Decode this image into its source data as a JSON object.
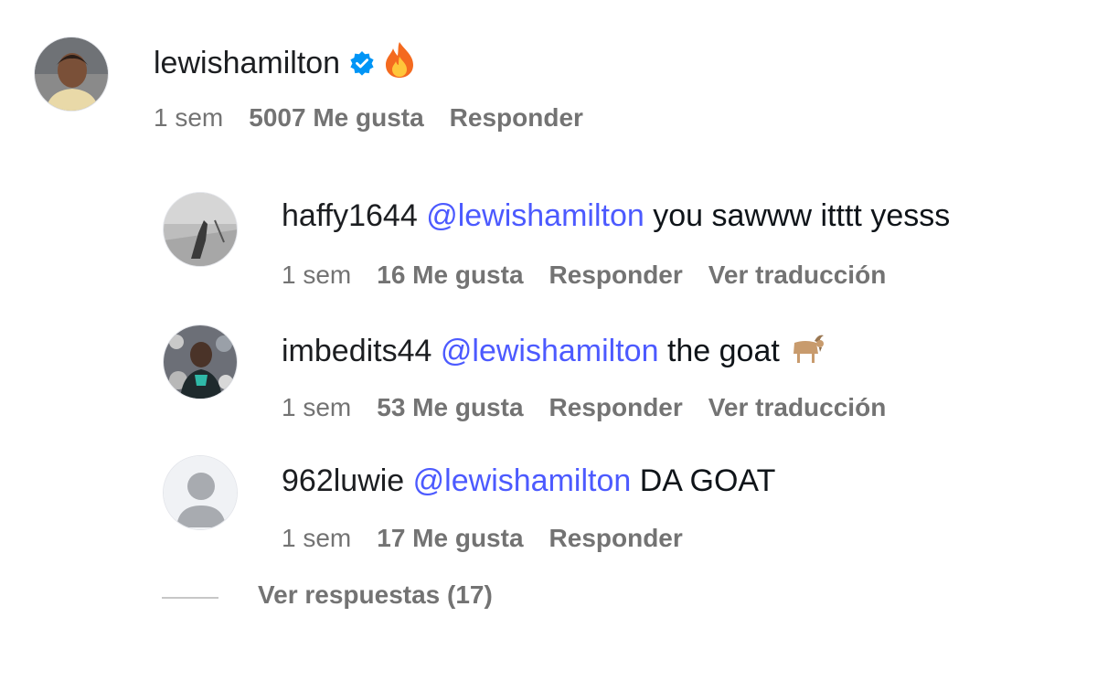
{
  "main_comment": {
    "username": "lewishamilton",
    "verified_icon": "verified-badge-icon",
    "emoji_icon": "fire-emoji-icon",
    "time": "1 sem",
    "likes": "5007 Me gusta",
    "reply": "Responder"
  },
  "replies": [
    {
      "username": "haffy1644",
      "mention": "@lewishamilton",
      "text": "you sawww itttt yesss",
      "time": "1 sem",
      "likes": "16 Me gusta",
      "reply": "Responder",
      "translate": "Ver traducción"
    },
    {
      "username": "imbedits44",
      "mention": "@lewishamilton",
      "text": "the goat",
      "emoji_icon": "goat-emoji-icon",
      "time": "1 sem",
      "likes": "53 Me gusta",
      "reply": "Responder",
      "translate": "Ver traducción"
    },
    {
      "username": "962luwie",
      "mention": "@lewishamilton",
      "text": "DA GOAT",
      "time": "1 sem",
      "likes": "17 Me gusta",
      "reply": "Responder"
    }
  ],
  "view_replies": "Ver respuestas (17)",
  "colors": {
    "mention": "#4c5aff",
    "meta": "#737373",
    "verified": "#0095f6"
  }
}
